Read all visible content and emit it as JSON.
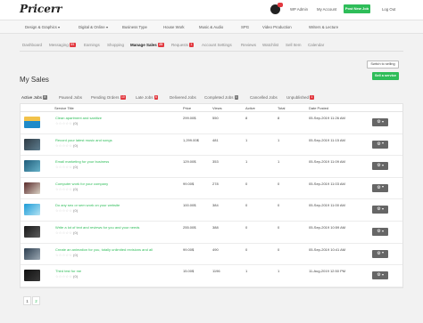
{
  "app": {
    "logo": "Pricerr"
  },
  "header": {
    "wp_admin": "WP Admin",
    "my_account": "My Account",
    "post_new_job": "Post New Job",
    "log_out": "Log Out"
  },
  "categories": [
    {
      "label": "Design & Graphics",
      "dropdown": true
    },
    {
      "label": "Digital & Online",
      "dropdown": true
    },
    {
      "label": "Business Type",
      "dropdown": false
    },
    {
      "label": "House Work",
      "dropdown": false
    },
    {
      "label": "Music & Audio",
      "dropdown": false
    },
    {
      "label": "SPG",
      "dropdown": false
    },
    {
      "label": "Video Production",
      "dropdown": false
    },
    {
      "label": "Writers & Lecture",
      "dropdown": false
    }
  ],
  "subnav": [
    {
      "label": "Dashboard",
      "badge": ""
    },
    {
      "label": "Messaging",
      "badge": "89"
    },
    {
      "label": "Earnings",
      "badge": ""
    },
    {
      "label": "Shopping",
      "badge": ""
    },
    {
      "label": "Manage Sales",
      "badge": "25",
      "active": true
    },
    {
      "label": "Requests",
      "badge": "1"
    },
    {
      "label": "Account Settings",
      "badge": ""
    },
    {
      "label": "Reviews",
      "badge": ""
    },
    {
      "label": "Watchlist",
      "badge": ""
    },
    {
      "label": "Sell Item",
      "badge": ""
    },
    {
      "label": "Calendar",
      "badge": ""
    }
  ],
  "actions": {
    "switch_to_selling": "Switch to selling",
    "sell_a_service": "Sell a service"
  },
  "page_title": "My Sales",
  "tabs": [
    {
      "label": "Active Jobs",
      "badge": "8",
      "gray": true,
      "active": true
    },
    {
      "label": "Paused Jobs",
      "badge": "",
      "gray": false
    },
    {
      "label": "Pending Orders",
      "badge": "10",
      "gray": false
    },
    {
      "label": "Late Jobs",
      "badge": "6",
      "gray": false
    },
    {
      "label": "Delivered Jobs",
      "badge": "",
      "gray": false
    },
    {
      "label": "Completed Jobs",
      "badge": "1",
      "gray": true
    },
    {
      "label": "Cancelled Jobs",
      "badge": "",
      "gray": false
    },
    {
      "label": "Unpublished",
      "badge": "1",
      "gray": false
    }
  ],
  "table": {
    "headers": [
      "Service Title",
      "Price",
      "Views",
      "Active",
      "Total",
      "Date Posted"
    ],
    "rows": [
      {
        "title": "Clean apartment and sanitize",
        "rating": "(0)",
        "price": "299.00$",
        "views": "550",
        "active": "8",
        "total": "8",
        "date": "05-Sep-2019 11:26 AM",
        "thumb": "thumb-a"
      },
      {
        "title": "Record your latest music and songs",
        "rating": "(0)",
        "price": "1,299.00$",
        "views": "481",
        "active": "1",
        "total": "1",
        "date": "05-Sep-2019 11:15 AM",
        "thumb": "thumb-b"
      },
      {
        "title": "Email marketing for your business",
        "rating": "(0)",
        "price": "129.00$",
        "views": "353",
        "active": "1",
        "total": "1",
        "date": "05-Sep-2019 11:09 AM",
        "thumb": "thumb-c"
      },
      {
        "title": "Computer work for your company",
        "rating": "(0)",
        "price": "99.00$",
        "views": "278",
        "active": "0",
        "total": "0",
        "date": "05-Sep-2019 11:03 AM",
        "thumb": "thumb-d"
      },
      {
        "title": "Do any seo or sem work on your website",
        "rating": "(0)",
        "price": "100.00$",
        "views": "384",
        "active": "0",
        "total": "0",
        "date": "05-Sep-2019 11:00 AM",
        "thumb": "thumb-e"
      },
      {
        "title": "Write a lot of text and reviews for you and your needs",
        "rating": "(0)",
        "price": "255.00$",
        "views": "388",
        "active": "0",
        "total": "0",
        "date": "05-Sep-2019 10:59 AM",
        "thumb": "thumb-f"
      },
      {
        "title": "Create an animation for you, totally unlimited revisions and all",
        "rating": "(0)",
        "price": "99.00$",
        "views": "490",
        "active": "0",
        "total": "0",
        "date": "05-Sep-2019 10:41 AM",
        "thumb": "thumb-g"
      },
      {
        "title": "Third test for me",
        "rating": "(0)",
        "price": "15.00$",
        "views": "1196",
        "active": "1",
        "total": "1",
        "date": "11-Aug-2019 12:50 PM",
        "thumb": "thumb-h"
      }
    ]
  },
  "pagination": [
    "1",
    "2"
  ],
  "icons": {
    "gear": "gear-icon",
    "star": "star-icon",
    "caret": "chevron-down-icon"
  },
  "colors": {
    "accent": "#2ebd59",
    "badge": "#e2383f",
    "button_dark": "#666666"
  }
}
